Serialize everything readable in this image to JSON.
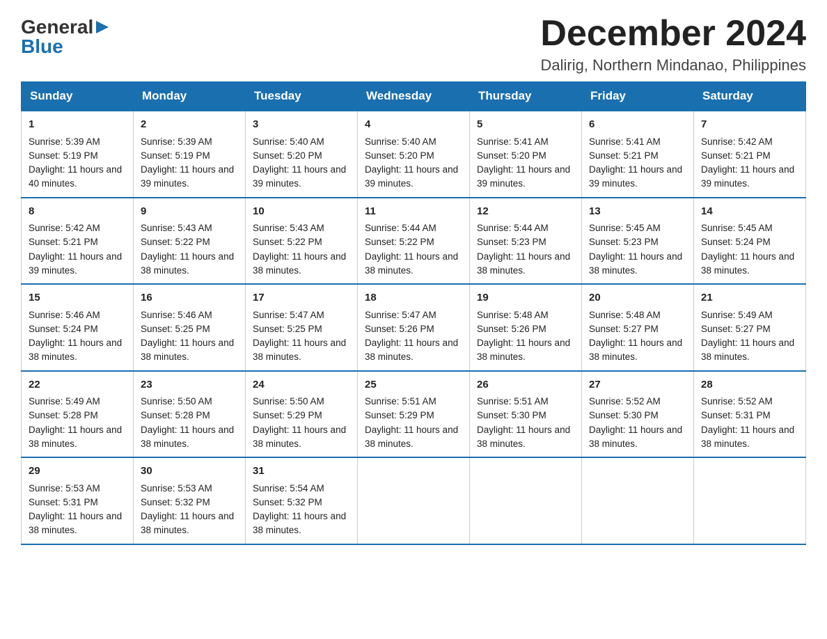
{
  "logo": {
    "general": "General",
    "blue": "Blue"
  },
  "title": {
    "month_year": "December 2024",
    "location": "Dalirig, Northern Mindanao, Philippines"
  },
  "days_of_week": [
    "Sunday",
    "Monday",
    "Tuesday",
    "Wednesday",
    "Thursday",
    "Friday",
    "Saturday"
  ],
  "weeks": [
    [
      {
        "day": "1",
        "sunrise": "Sunrise: 5:39 AM",
        "sunset": "Sunset: 5:19 PM",
        "daylight": "Daylight: 11 hours and 40 minutes."
      },
      {
        "day": "2",
        "sunrise": "Sunrise: 5:39 AM",
        "sunset": "Sunset: 5:19 PM",
        "daylight": "Daylight: 11 hours and 39 minutes."
      },
      {
        "day": "3",
        "sunrise": "Sunrise: 5:40 AM",
        "sunset": "Sunset: 5:20 PM",
        "daylight": "Daylight: 11 hours and 39 minutes."
      },
      {
        "day": "4",
        "sunrise": "Sunrise: 5:40 AM",
        "sunset": "Sunset: 5:20 PM",
        "daylight": "Daylight: 11 hours and 39 minutes."
      },
      {
        "day": "5",
        "sunrise": "Sunrise: 5:41 AM",
        "sunset": "Sunset: 5:20 PM",
        "daylight": "Daylight: 11 hours and 39 minutes."
      },
      {
        "day": "6",
        "sunrise": "Sunrise: 5:41 AM",
        "sunset": "Sunset: 5:21 PM",
        "daylight": "Daylight: 11 hours and 39 minutes."
      },
      {
        "day": "7",
        "sunrise": "Sunrise: 5:42 AM",
        "sunset": "Sunset: 5:21 PM",
        "daylight": "Daylight: 11 hours and 39 minutes."
      }
    ],
    [
      {
        "day": "8",
        "sunrise": "Sunrise: 5:42 AM",
        "sunset": "Sunset: 5:21 PM",
        "daylight": "Daylight: 11 hours and 39 minutes."
      },
      {
        "day": "9",
        "sunrise": "Sunrise: 5:43 AM",
        "sunset": "Sunset: 5:22 PM",
        "daylight": "Daylight: 11 hours and 38 minutes."
      },
      {
        "day": "10",
        "sunrise": "Sunrise: 5:43 AM",
        "sunset": "Sunset: 5:22 PM",
        "daylight": "Daylight: 11 hours and 38 minutes."
      },
      {
        "day": "11",
        "sunrise": "Sunrise: 5:44 AM",
        "sunset": "Sunset: 5:22 PM",
        "daylight": "Daylight: 11 hours and 38 minutes."
      },
      {
        "day": "12",
        "sunrise": "Sunrise: 5:44 AM",
        "sunset": "Sunset: 5:23 PM",
        "daylight": "Daylight: 11 hours and 38 minutes."
      },
      {
        "day": "13",
        "sunrise": "Sunrise: 5:45 AM",
        "sunset": "Sunset: 5:23 PM",
        "daylight": "Daylight: 11 hours and 38 minutes."
      },
      {
        "day": "14",
        "sunrise": "Sunrise: 5:45 AM",
        "sunset": "Sunset: 5:24 PM",
        "daylight": "Daylight: 11 hours and 38 minutes."
      }
    ],
    [
      {
        "day": "15",
        "sunrise": "Sunrise: 5:46 AM",
        "sunset": "Sunset: 5:24 PM",
        "daylight": "Daylight: 11 hours and 38 minutes."
      },
      {
        "day": "16",
        "sunrise": "Sunrise: 5:46 AM",
        "sunset": "Sunset: 5:25 PM",
        "daylight": "Daylight: 11 hours and 38 minutes."
      },
      {
        "day": "17",
        "sunrise": "Sunrise: 5:47 AM",
        "sunset": "Sunset: 5:25 PM",
        "daylight": "Daylight: 11 hours and 38 minutes."
      },
      {
        "day": "18",
        "sunrise": "Sunrise: 5:47 AM",
        "sunset": "Sunset: 5:26 PM",
        "daylight": "Daylight: 11 hours and 38 minutes."
      },
      {
        "day": "19",
        "sunrise": "Sunrise: 5:48 AM",
        "sunset": "Sunset: 5:26 PM",
        "daylight": "Daylight: 11 hours and 38 minutes."
      },
      {
        "day": "20",
        "sunrise": "Sunrise: 5:48 AM",
        "sunset": "Sunset: 5:27 PM",
        "daylight": "Daylight: 11 hours and 38 minutes."
      },
      {
        "day": "21",
        "sunrise": "Sunrise: 5:49 AM",
        "sunset": "Sunset: 5:27 PM",
        "daylight": "Daylight: 11 hours and 38 minutes."
      }
    ],
    [
      {
        "day": "22",
        "sunrise": "Sunrise: 5:49 AM",
        "sunset": "Sunset: 5:28 PM",
        "daylight": "Daylight: 11 hours and 38 minutes."
      },
      {
        "day": "23",
        "sunrise": "Sunrise: 5:50 AM",
        "sunset": "Sunset: 5:28 PM",
        "daylight": "Daylight: 11 hours and 38 minutes."
      },
      {
        "day": "24",
        "sunrise": "Sunrise: 5:50 AM",
        "sunset": "Sunset: 5:29 PM",
        "daylight": "Daylight: 11 hours and 38 minutes."
      },
      {
        "day": "25",
        "sunrise": "Sunrise: 5:51 AM",
        "sunset": "Sunset: 5:29 PM",
        "daylight": "Daylight: 11 hours and 38 minutes."
      },
      {
        "day": "26",
        "sunrise": "Sunrise: 5:51 AM",
        "sunset": "Sunset: 5:30 PM",
        "daylight": "Daylight: 11 hours and 38 minutes."
      },
      {
        "day": "27",
        "sunrise": "Sunrise: 5:52 AM",
        "sunset": "Sunset: 5:30 PM",
        "daylight": "Daylight: 11 hours and 38 minutes."
      },
      {
        "day": "28",
        "sunrise": "Sunrise: 5:52 AM",
        "sunset": "Sunset: 5:31 PM",
        "daylight": "Daylight: 11 hours and 38 minutes."
      }
    ],
    [
      {
        "day": "29",
        "sunrise": "Sunrise: 5:53 AM",
        "sunset": "Sunset: 5:31 PM",
        "daylight": "Daylight: 11 hours and 38 minutes."
      },
      {
        "day": "30",
        "sunrise": "Sunrise: 5:53 AM",
        "sunset": "Sunset: 5:32 PM",
        "daylight": "Daylight: 11 hours and 38 minutes."
      },
      {
        "day": "31",
        "sunrise": "Sunrise: 5:54 AM",
        "sunset": "Sunset: 5:32 PM",
        "daylight": "Daylight: 11 hours and 38 minutes."
      },
      null,
      null,
      null,
      null
    ]
  ]
}
